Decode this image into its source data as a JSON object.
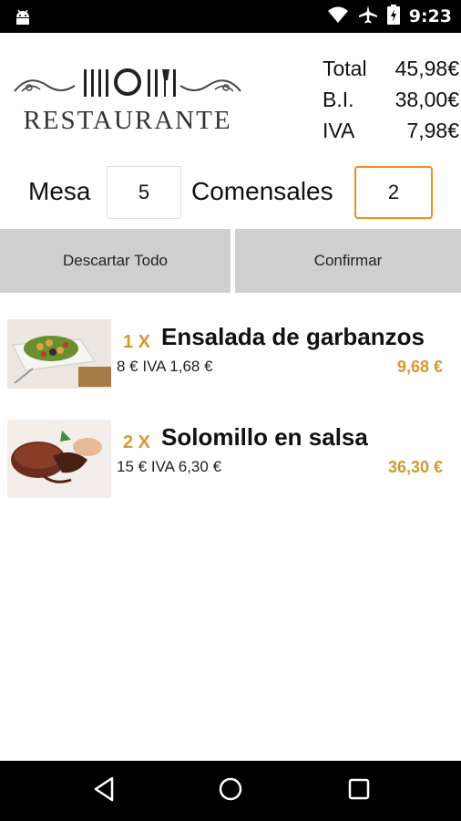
{
  "status_bar": {
    "time": "9:23",
    "icons": [
      "android-icon",
      "wifi-icon",
      "airplane-icon",
      "battery-icon"
    ]
  },
  "header": {
    "logo_text": "RESTAURANTE",
    "totals": [
      {
        "label": "Total",
        "value": "45,98€"
      },
      {
        "label": "B.I.",
        "value": "38,00€"
      },
      {
        "label": "IVA",
        "value": "7,98€"
      }
    ]
  },
  "form": {
    "mesa_label": "Mesa",
    "mesa_value": "5",
    "comensales_label": "Comensales",
    "comensales_value": "2"
  },
  "actions": {
    "discard_label": "Descartar Todo",
    "confirm_label": "Confirmar"
  },
  "order_items": [
    {
      "qty": "1 X",
      "name": "Ensalada de garbanzos",
      "price": "8 €",
      "iva": "IVA 1,68 €",
      "total": "9,68 €",
      "image": "chickpea-salad-photo"
    },
    {
      "qty": "2 X",
      "name": "Solomillo en salsa",
      "price": "15 €",
      "iva": "IVA 6,30 €",
      "total": "36,30 €",
      "image": "sirloin-steak-photo"
    }
  ],
  "colors": {
    "accent": "#d19a2e",
    "focus_border": "#f28c1c",
    "button_bg": "#cfcfcf"
  }
}
